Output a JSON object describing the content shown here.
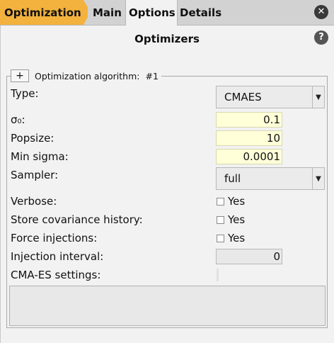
{
  "tabs": {
    "optimization": "Optimization",
    "main": "Main",
    "options": "Options",
    "details": "Details"
  },
  "window": {
    "close_glyph": "✕",
    "help_glyph": "?"
  },
  "header": {
    "title": "Optimizers"
  },
  "group": {
    "add_glyph": "+",
    "label": "Optimization algorithm:",
    "number": "#1"
  },
  "form": {
    "type": {
      "label": "Type:",
      "value": "CMAES"
    },
    "sigma0": {
      "label": "σ₀:",
      "value": "0.1"
    },
    "popsize": {
      "label": "Popsize:",
      "value": "10"
    },
    "min_sigma": {
      "label": "Min sigma:",
      "value": "0.0001"
    },
    "sampler": {
      "label": "Sampler:",
      "value": "full"
    },
    "verbose": {
      "label": "Verbose:",
      "option": "Yes",
      "checked": false
    },
    "store_cov": {
      "label": "Store covariance history:",
      "option": "Yes",
      "checked": false
    },
    "force_inj": {
      "label": "Force injections:",
      "option": "Yes",
      "checked": false
    },
    "inj_interval": {
      "label": "Injection interval:",
      "value": "0"
    },
    "cma_settings": {
      "label": "CMA-ES settings:"
    }
  },
  "icons": {
    "dropdown": "▼"
  },
  "colors": {
    "active_tab": "#f3b23d",
    "numeric_field": "#ffffd8",
    "disabled_field": "#e8e8e8"
  }
}
